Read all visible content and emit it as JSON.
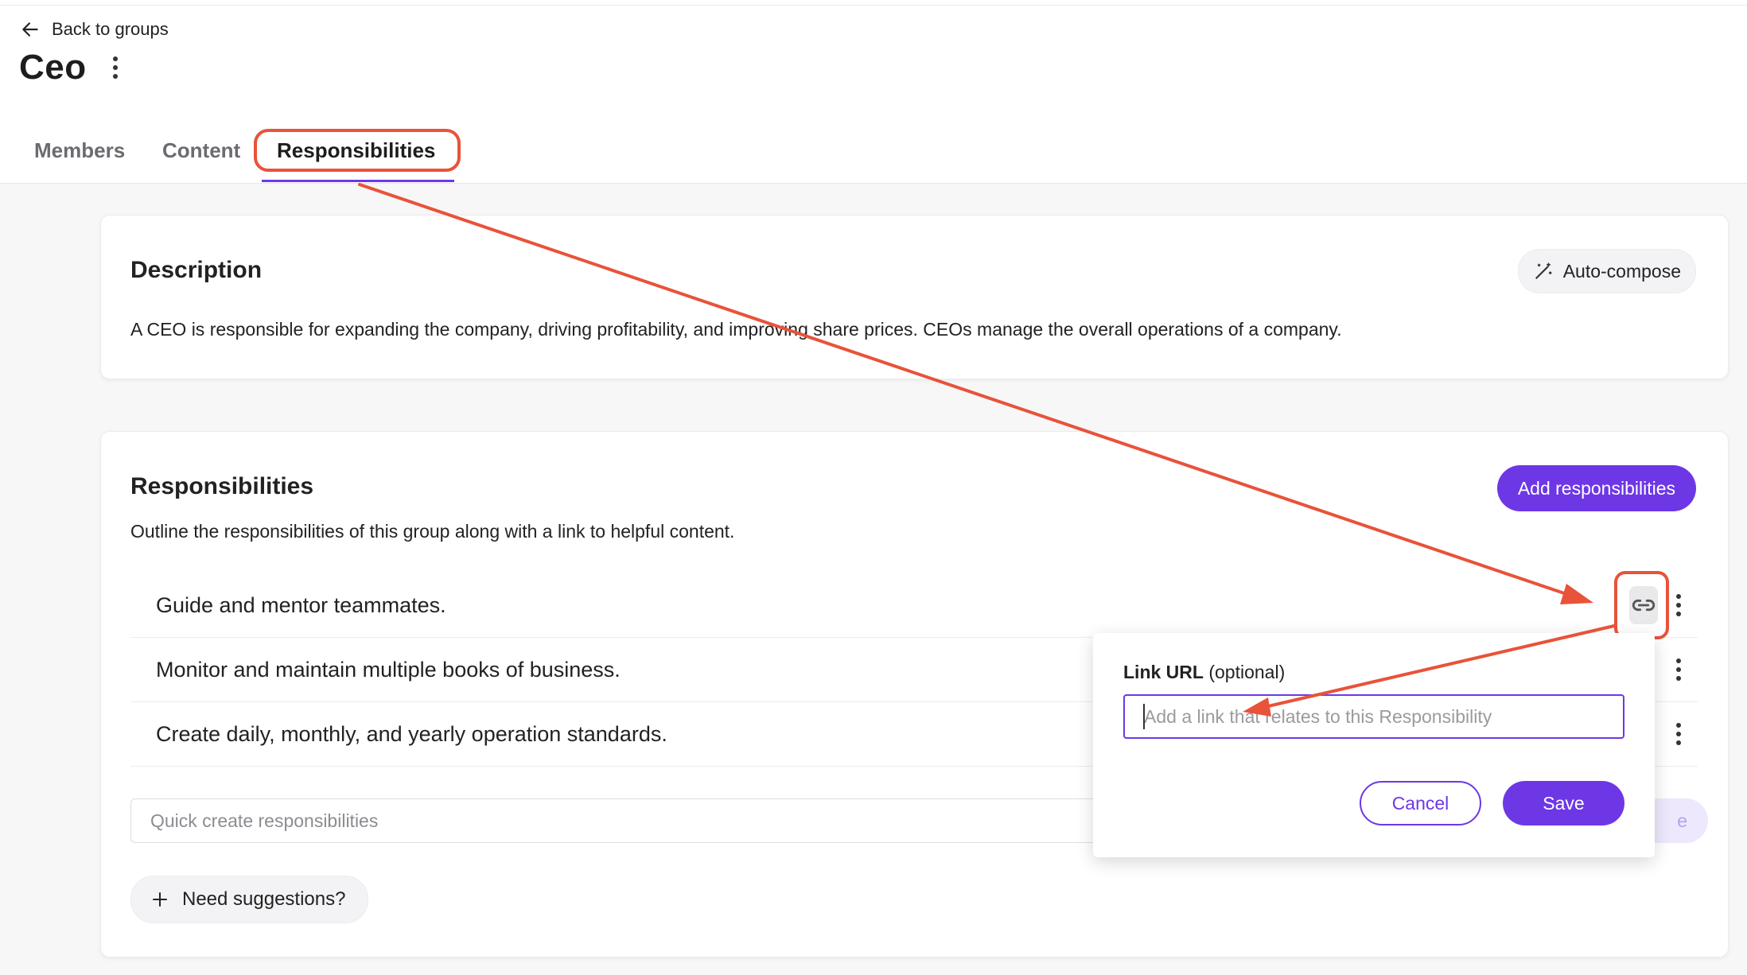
{
  "header": {
    "back_label": "Back to groups",
    "title": "Ceo",
    "tabs": [
      {
        "label": "Members",
        "active": false
      },
      {
        "label": "Content",
        "active": false
      },
      {
        "label": "Responsibilities",
        "active": true
      }
    ]
  },
  "description": {
    "title": "Description",
    "auto_compose_label": "Auto-compose",
    "text": "A CEO is responsible for expanding the company, driving profitability, and improving share prices. CEOs manage the overall operations of a company."
  },
  "responsibilities": {
    "title": "Responsibilities",
    "add_label": "Add responsibilities",
    "subtitle": "Outline the responsibilities of this group along with a link to helpful content.",
    "items": [
      {
        "text": "Guide and mentor teammates."
      },
      {
        "text": "Monitor and maintain multiple books of business."
      },
      {
        "text": "Create daily, monthly, and yearly operation standards."
      }
    ],
    "quick_create_placeholder": "Quick create responsibilities",
    "create_button_partial": "e",
    "suggest_label": "Need suggestions?"
  },
  "link_popover": {
    "label_strong": "Link URL",
    "label_hint": "(optional)",
    "placeholder": "Add a link that relates to this Responsibility",
    "cancel_label": "Cancel",
    "save_label": "Save"
  },
  "colors": {
    "accent": "#6d37e6",
    "annotation": "#e8533a"
  },
  "icons": [
    "arrow-left-icon",
    "more-vertical-icon",
    "magic-wand-icon",
    "link-icon",
    "plus-icon"
  ]
}
